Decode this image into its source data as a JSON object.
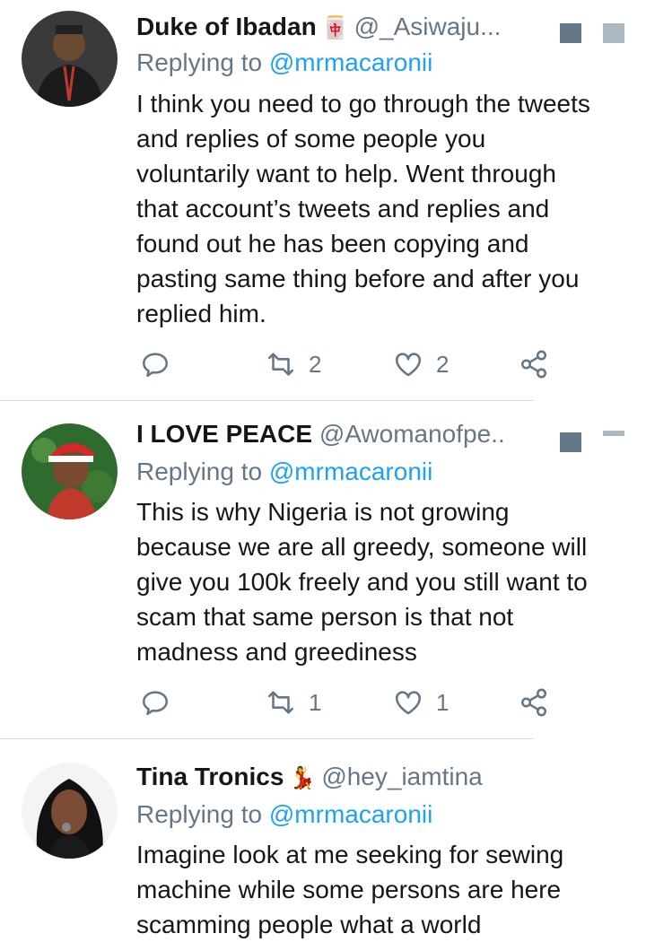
{
  "tweets": [
    {
      "name": "Duke of Ibadan",
      "name_emoji": "🀄",
      "handle": "@_Asiwaju...",
      "replying_prefix": "Replying to ",
      "replying_to": "@mrmacaronii",
      "body": [
        "I think you need to go through the tweets",
        "and replies of some people you",
        "voluntarily want to help. Went through",
        "that account’s tweets and replies and",
        "found out he has been copying and",
        "pasting same thing before and after you",
        "replied him."
      ],
      "retweets": "2",
      "likes": "2",
      "avatar_icon": "user-avatar"
    },
    {
      "name": "I LOVE PEACE",
      "name_emoji": "",
      "handle": "@Awomanofpe..",
      "replying_prefix": "Replying to ",
      "replying_to": "@mrmacaronii",
      "body": [
        "This is why Nigeria is not growing",
        "because we are all greedy, someone will",
        "give you 100k freely and you still want to",
        "scam that same person is that not",
        "madness and greediness"
      ],
      "retweets": "1",
      "likes": "1",
      "avatar_icon": "user-avatar"
    },
    {
      "name": "Tina Tronics",
      "name_emoji": "💃",
      "handle": "@hey_iamtina",
      "replying_prefix": "Replying to ",
      "replying_to": "@mrmacaronii",
      "body": [
        "Imagine look at me seeking for sewing",
        "machine while some persons are here",
        "scamming people what a world"
      ],
      "avatar_icon": "user-avatar"
    }
  ],
  "icons": [
    "reply-icon",
    "retweet-icon",
    "like-icon",
    "share-icon"
  ],
  "colors": {
    "text": "#14171a",
    "secondary": "#657786",
    "link": "#1da1f2",
    "divider": "#d8dde1"
  }
}
